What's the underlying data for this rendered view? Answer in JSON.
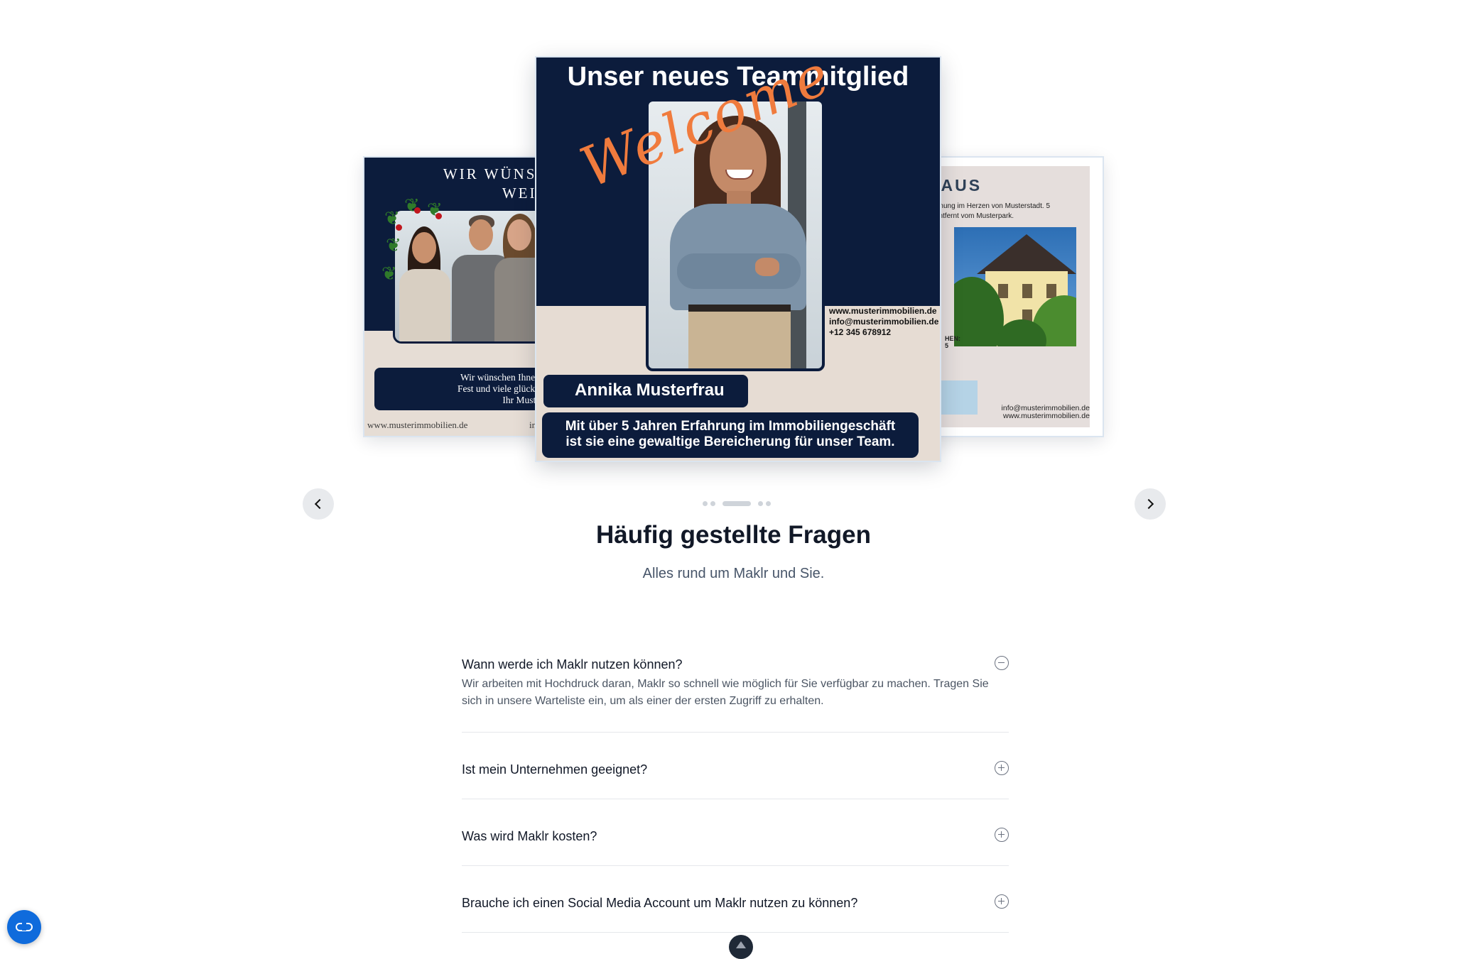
{
  "carousel": {
    "slides": {
      "left": {
        "heading_line1": "WIR WÜNSCHEN IH",
        "heading_line2": "WEIHNACHT",
        "message_line1": "Wir wünschen Ihnen und Ihren L",
        "message_line2": "Fest und viele glückliche Stunden",
        "message_line3": "Ihr Musterimmobilien",
        "url": "www.musterimmobilien.de",
        "url_fragment": "in"
      },
      "center": {
        "title": "Unser neues Teammitglied",
        "script_text": "Welcome",
        "contact_web": "www.musterimmobilien.de",
        "contact_mail": "info@musterimmobilien.de",
        "contact_phone": "+12 345 678912",
        "name": "Annika Musterfrau",
        "bio_line1": "Mit über 5 Jahren Erfahrung im Immobiliengeschäft",
        "bio_line2": "ist sie eine gewaltige Bereicherung für unser Team."
      },
      "right": {
        "title": "MMER-HAUS",
        "desc_line1": "Wohnung im Herzen von Musterstadt. 5",
        "desc_line2": "en entfernt vom Musterpark.",
        "side_label": "HEN:",
        "side_small": "5",
        "button_fragment": "c",
        "contact_mail": "info@musterimmobilien.de",
        "contact_web": "www.musterimmobilien.de"
      }
    },
    "prev_icon": "chevron-left-icon",
    "next_icon": "chevron-right-icon",
    "dot_count": 5,
    "active_dot": 3
  },
  "faq": {
    "title": "Häufig gestellte Fragen",
    "subtitle": "Alles rund um Maklr und Sie.",
    "items": [
      {
        "question": "Wann werde ich Maklr nutzen können?",
        "answer": "Wir arbeiten mit Hochdruck daran, Maklr so schnell wie möglich für Sie verfügbar zu machen. Tragen Sie sich in unsere Warteliste ein, um als einer der ersten Zugriff zu erhalten.",
        "open": true,
        "icon": "minus-circle-icon"
      },
      {
        "question": "Ist mein Unternehmen geeignet?",
        "open": false,
        "icon": "plus-circle-icon"
      },
      {
        "question": "Was wird Maklr kosten?",
        "open": false,
        "icon": "plus-circle-icon"
      },
      {
        "question": "Brauche ich einen Social Media Account um Maklr nutzen zu können?",
        "open": false,
        "icon": "plus-circle-icon"
      }
    ]
  },
  "widgets": {
    "fab_icon": "link-icon",
    "badge_icon": "app-logo-icon"
  },
  "colors": {
    "navy": "#0c1c3c",
    "beige": "#e6dcd3",
    "accent_orange": "#f07b3d",
    "fab_blue": "#0f6bdc"
  }
}
